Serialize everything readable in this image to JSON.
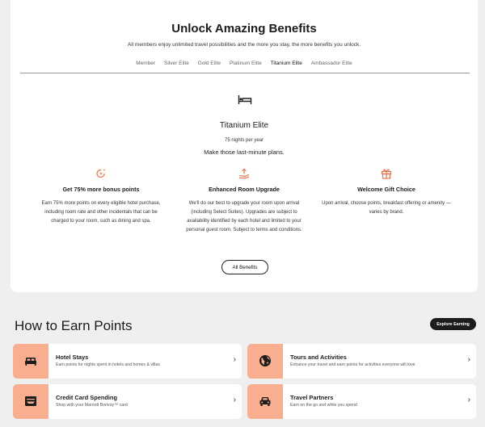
{
  "benefits_section": {
    "title": "Unlock Amazing Benefits",
    "subtitle": "All members enjoy unlimited travel possibilities and the more you stay, the more benefits you unlock.",
    "tabs": [
      {
        "label": "Member",
        "active": false
      },
      {
        "label": "Silver Elite",
        "active": false
      },
      {
        "label": "Gold Elite",
        "active": false
      },
      {
        "label": "Platinum Elite",
        "active": false
      },
      {
        "label": "Titanium Elite",
        "active": true
      },
      {
        "label": "Ambassador Elite",
        "active": false
      }
    ],
    "tier": {
      "icon": "hotel-bed-icon",
      "name": "Titanium Elite",
      "nights": "75 nights per year",
      "tagline": "Make those last-minute plans."
    },
    "items": [
      {
        "icon": "bonus-points-icon",
        "title": "Get 75% more bonus points",
        "description": "Earn 75% more points on every eligible hotel purchase, including room rate and other incidentals that can be charged to your room, such as dining and spa."
      },
      {
        "icon": "room-upgrade-icon",
        "title": "Enhanced Room Upgrade",
        "description": "We'll do our best to upgrade your room upon arrival (including Select Suites). Upgrades are subject to availability identified by each hotel and limited to your personal guest room. Subject to terms and conditions."
      },
      {
        "icon": "gift-icon",
        "title": "Welcome Gift Choice",
        "description": "Upon arrival, choose points, breakfast offering or amenity — varies by brand."
      }
    ],
    "all_benefits_label": "All Benefits"
  },
  "earn_section": {
    "title": "How to Earn Points",
    "explore_label": "Explore Earning",
    "cards": [
      {
        "icon": "bed-icon",
        "title": "Hotel Stays",
        "description": "Earn points for nights spent in hotels and homes & villas"
      },
      {
        "icon": "globe-icon",
        "title": "Tours and Activities",
        "description": "Enhance your travel and earn points for activities everyone will love"
      },
      {
        "icon": "credit-card-icon",
        "title": "Credit Card Spending",
        "description": "Shop with your Marriott Bonvoy™ card"
      },
      {
        "icon": "car-icon",
        "title": "Travel Partners",
        "description": "Earn on the go and while you spend"
      }
    ]
  },
  "colors": {
    "accent": "#e8734a",
    "icon_tile": "#f8ae8f",
    "dark_button": "#1c1c1c",
    "page_background": "#efefef"
  }
}
